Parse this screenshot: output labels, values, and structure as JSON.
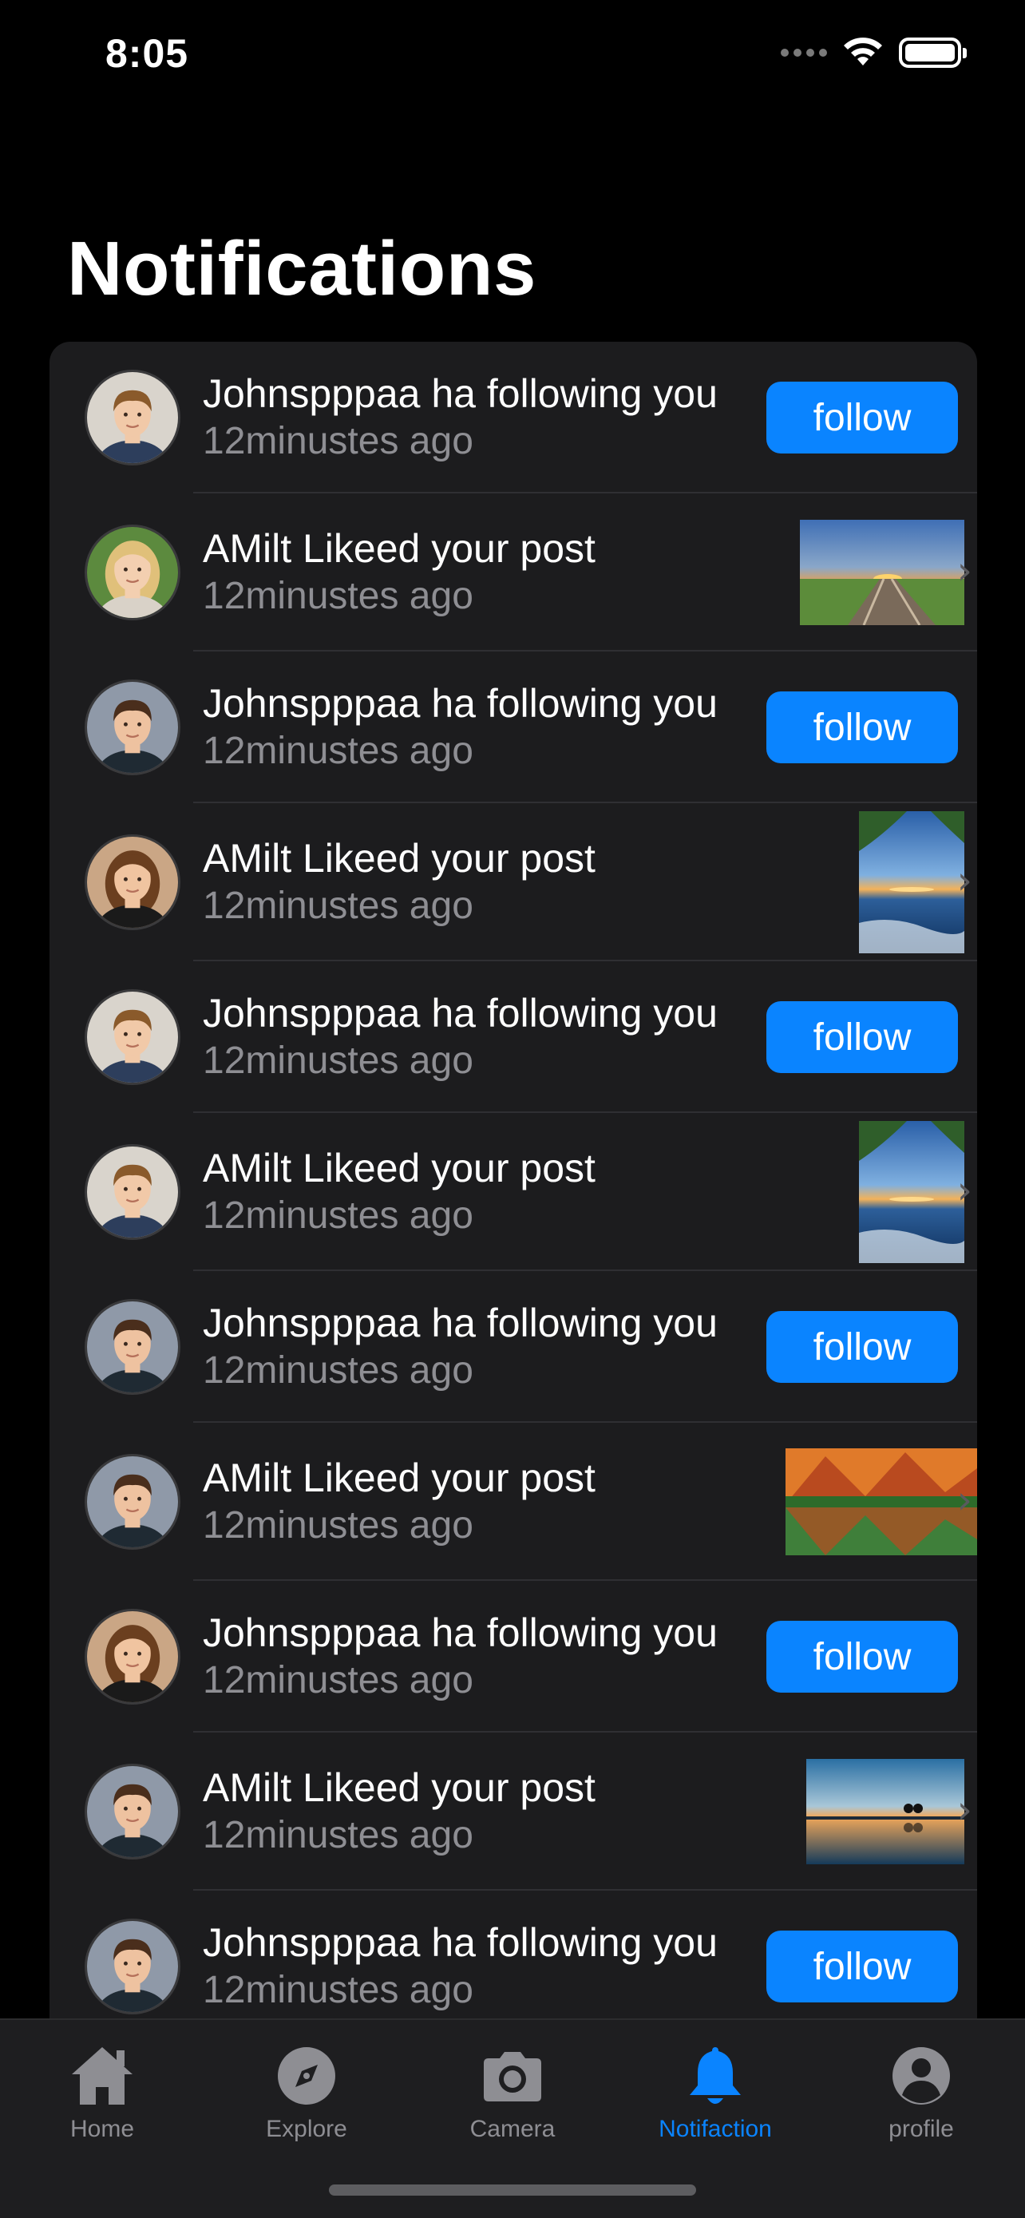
{
  "status_bar": {
    "time": "8:05"
  },
  "page": {
    "title": "Notifications"
  },
  "notifications": [
    {
      "title": "Johnspppaa ha following you",
      "time": "12minustes ago",
      "action": "follow",
      "avatar": "boy-curly",
      "thumb": null
    },
    {
      "title": "AMilt Likeed your post",
      "time": "12minustes ago",
      "action": null,
      "avatar": "girl-blonde",
      "thumb": "railroad-sunset"
    },
    {
      "title": "Johnspppaa ha following you",
      "time": "12minustes ago",
      "action": "follow",
      "avatar": "boy-short",
      "thumb": null
    },
    {
      "title": "AMilt Likeed your post",
      "time": "12minustes ago",
      "action": null,
      "avatar": "girl-brunette",
      "thumb": "sea-sunset"
    },
    {
      "title": "Johnspppaa ha following you",
      "time": "12minustes ago",
      "action": "follow",
      "avatar": "boy-curly",
      "thumb": null
    },
    {
      "title": "AMilt Likeed your post",
      "time": "12minustes ago",
      "action": null,
      "avatar": "boy-curly",
      "thumb": "sea-sunset"
    },
    {
      "title": "Johnspppaa ha following you",
      "time": "12minustes ago",
      "action": "follow",
      "avatar": "boy-short",
      "thumb": null
    },
    {
      "title": "AMilt Likeed your post",
      "time": "12minustes ago",
      "action": null,
      "avatar": "boy-short",
      "thumb": "mountain-lake"
    },
    {
      "title": "Johnspppaa ha following you",
      "time": "12minustes ago",
      "action": "follow",
      "avatar": "girl-brunette",
      "thumb": null
    },
    {
      "title": "AMilt Likeed your post",
      "time": "12minustes ago",
      "action": null,
      "avatar": "boy-short",
      "thumb": "lake-dusk"
    },
    {
      "title": "Johnspppaa ha following you",
      "time": "12minustes ago",
      "action": "follow",
      "avatar": "boy-short",
      "thumb": null
    }
  ],
  "tab_bar": {
    "tabs": [
      {
        "label": "Home",
        "icon": "house-icon",
        "active": false
      },
      {
        "label": "Explore",
        "icon": "compass-icon",
        "active": false
      },
      {
        "label": "Camera",
        "icon": "camera-icon",
        "active": false
      },
      {
        "label": "Notifaction",
        "icon": "bell-icon",
        "active": true
      },
      {
        "label": "profile",
        "icon": "person-icon",
        "active": false
      }
    ]
  },
  "colors": {
    "accent": "#0a84ff",
    "row_bg": "#1c1c1e",
    "secondary_text": "#8e8e93",
    "background": "#000000"
  }
}
